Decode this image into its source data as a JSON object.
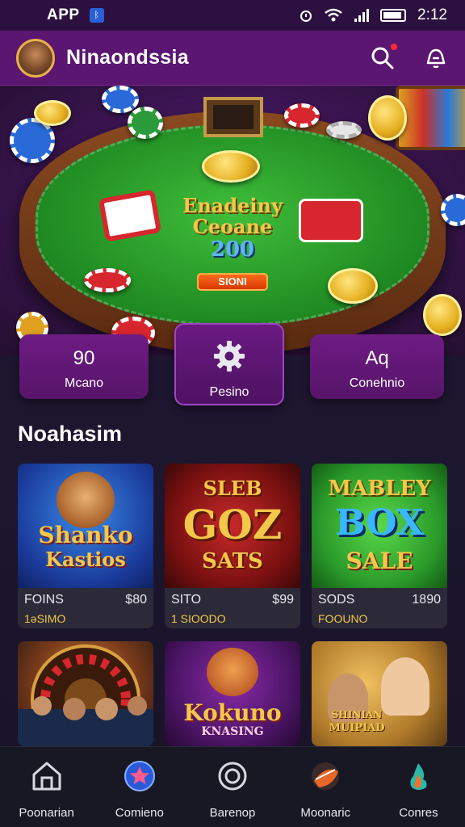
{
  "status_bar": {
    "app_label": "APP",
    "time": "2:12"
  },
  "header": {
    "brand": "Ninaondssia"
  },
  "hero": {
    "title_line1": "Enadeiny",
    "title_line2": "Ceoane",
    "title_number": "200",
    "button_label": "SIONI"
  },
  "stats": [
    {
      "value": "90",
      "label": "Mcano"
    },
    {
      "value": "",
      "label": "Pesino"
    },
    {
      "value": "Aq",
      "label": "Conehnio"
    }
  ],
  "section": {
    "title": "Noahasim"
  },
  "games": [
    {
      "art_line1": "Shanko",
      "art_line2": "Kastios",
      "name": "FOINS",
      "price": "$80",
      "sub": "1ǝSIMO"
    },
    {
      "art_line1": "SLEB",
      "art_line2": "GOZ",
      "art_line3": "SATS",
      "name": "SITO",
      "price": "$99",
      "sub": "1 SIOODO"
    },
    {
      "art_line1": "MABLEY",
      "art_line2": "BOX",
      "art_line3": "SALE",
      "name": "SODS",
      "price": "1890",
      "sub": "FOOUNO"
    },
    {
      "art_line1": "",
      "name": "",
      "price": "",
      "sub": ""
    },
    {
      "art_line1": "Kokuno",
      "art_line2": "KNASING"
    },
    {
      "art_line1": "SHINIAN",
      "art_line2": "MUIPIAD"
    }
  ],
  "bottom_nav": [
    {
      "label": "Poonarian",
      "icon": "house-icon"
    },
    {
      "label": "Comieno",
      "icon": "star-badge-icon"
    },
    {
      "label": "Barenop",
      "icon": "ring-icon"
    },
    {
      "label": "Moonaric",
      "icon": "moon-icon"
    },
    {
      "label": "Conres",
      "icon": "flame-icon"
    }
  ],
  "colors": {
    "header": "#5a1670",
    "accent": "#6e1c84",
    "gold": "#f3c84a",
    "background": "#1c1530"
  }
}
